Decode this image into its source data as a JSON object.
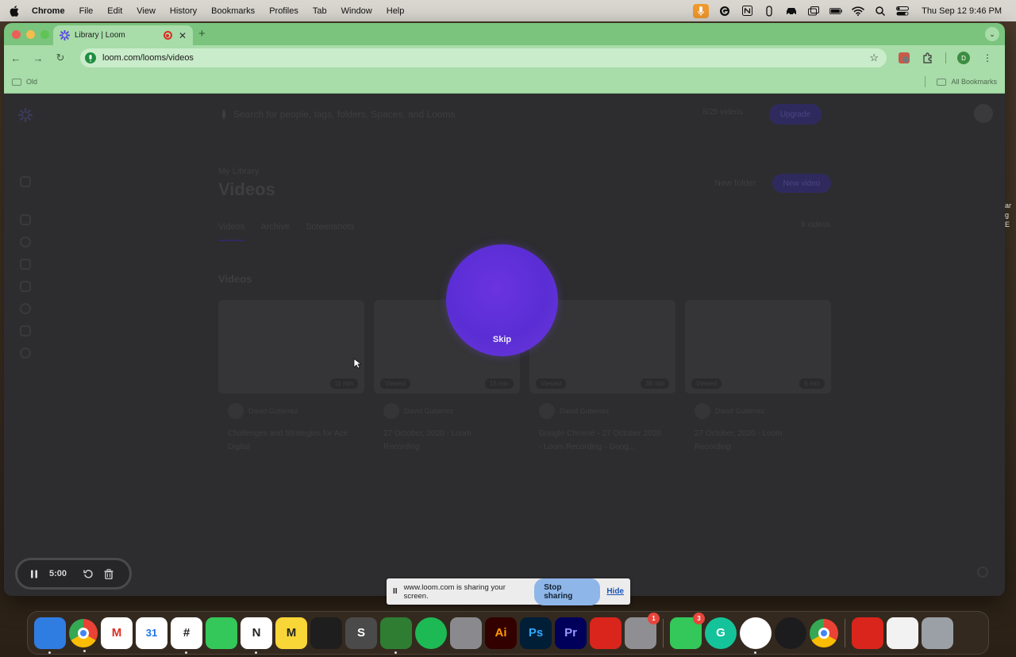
{
  "menubar": {
    "app_name": "Chrome",
    "menus": [
      "File",
      "Edit",
      "View",
      "History",
      "Bookmarks",
      "Profiles",
      "Tab",
      "Window",
      "Help"
    ],
    "clock": "Thu Sep 12  9:46 PM"
  },
  "browser": {
    "tab_title": "Library | Loom",
    "url": "loom.com/looms/videos",
    "bookmark_folder": "Old",
    "all_bookmarks": "All Bookmarks",
    "profile_initial": "D"
  },
  "page": {
    "search_placeholder": "Search for people, tags, folders, Spaces, and Looms",
    "usage": "8/25 videos",
    "upgrade": "Upgrade",
    "breadcrumb": "My Library",
    "title": "Videos",
    "new_folder": "New folder",
    "new_video": "New video",
    "tabs": [
      "Videos",
      "Archive",
      "Screenshots"
    ],
    "count": "8 videos",
    "section": "Videos",
    "cards": [
      {
        "owner": "David Gutierrez",
        "title": "Challenges and Strategies for Ace Digital",
        "duration": "11 min",
        "viewed": ""
      },
      {
        "owner": "David Gutierrez",
        "title": "27 October, 2020 - Loom Recording",
        "duration": "15 min",
        "viewed": "Viewed"
      },
      {
        "owner": "David Gutierrez",
        "title": "Google Chrome - 27 October 2020 - Loom Recording - Goog...",
        "duration": "38 min",
        "viewed": "Viewed"
      },
      {
        "owner": "David Gutierrez",
        "title": "27 October, 2020 - Loom Recording",
        "duration": "5 min",
        "viewed": "Viewed"
      }
    ]
  },
  "loom": {
    "skip": "Skip",
    "timer": "5:00"
  },
  "share_bar": {
    "pause": "II",
    "message": "www.loom.com is sharing your screen.",
    "stop": "Stop sharing",
    "hide": "Hide"
  },
  "desktop_text": "ar\ng\nE",
  "dock": {
    "apps": [
      {
        "name": "finder",
        "label": "",
        "color": "#2f7de1"
      },
      {
        "name": "chrome",
        "label": "",
        "color": "#ffffff"
      },
      {
        "name": "gmail",
        "label": "M",
        "color": "#ffffff"
      },
      {
        "name": "calendar",
        "label": "31",
        "color": "#ffffff"
      },
      {
        "name": "slack",
        "label": "#",
        "color": "#ffffff"
      },
      {
        "name": "messages",
        "label": "",
        "color": "#34c759"
      },
      {
        "name": "notion",
        "label": "N",
        "color": "#ffffff"
      },
      {
        "name": "miro",
        "label": "M",
        "color": "#f9d637"
      },
      {
        "name": "figma",
        "label": "",
        "color": "#1e1e1e"
      },
      {
        "name": "sublime",
        "label": "S",
        "color": "#4a4a4a"
      },
      {
        "name": "gecko",
        "label": "",
        "color": "#2e7d32"
      },
      {
        "name": "spotify",
        "label": "",
        "color": "#1db954"
      },
      {
        "name": "disk-utility",
        "label": "",
        "color": "#8a8a8e"
      },
      {
        "name": "illustrator",
        "label": "Ai",
        "color": "#330000"
      },
      {
        "name": "photoshop",
        "label": "Ps",
        "color": "#001e36"
      },
      {
        "name": "premiere",
        "label": "Pr",
        "color": "#00005b"
      },
      {
        "name": "acrobat",
        "label": "",
        "color": "#d9251c"
      },
      {
        "name": "system-settings",
        "label": "",
        "color": "#8e8e93",
        "badge": "1"
      },
      {
        "name": "facetime",
        "label": "",
        "color": "#34c759",
        "badge": "3"
      },
      {
        "name": "grammarly",
        "label": "G",
        "color": "#15c39a"
      },
      {
        "name": "safari",
        "label": "",
        "color": "#ffffff"
      },
      {
        "name": "quicktime",
        "label": "",
        "color": "#1c1c1e"
      },
      {
        "name": "chrome-2",
        "label": "",
        "color": "#ffffff"
      },
      {
        "name": "acrobat-2",
        "label": "",
        "color": "#d9251c"
      },
      {
        "name": "documents",
        "label": "",
        "color": "#f2f2f2"
      },
      {
        "name": "trash",
        "label": "",
        "color": "#9aa0a6"
      }
    ]
  }
}
